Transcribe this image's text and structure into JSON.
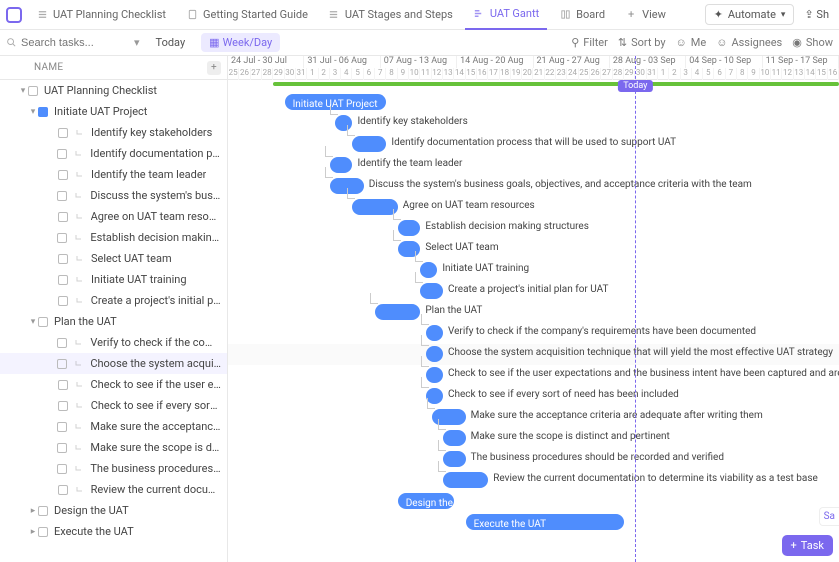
{
  "tabs": [
    {
      "label": "UAT Planning Checklist",
      "icon": "list-icon"
    },
    {
      "label": "Getting Started Guide",
      "icon": "doc-icon"
    },
    {
      "label": "UAT Stages and Steps",
      "icon": "list-icon"
    },
    {
      "label": "UAT Gantt",
      "icon": "gantt-icon",
      "active": true
    },
    {
      "label": "Board",
      "icon": "board-icon"
    },
    {
      "label": "View",
      "icon": "plus-icon"
    }
  ],
  "top_actions": {
    "automate": "Automate",
    "share": "Sh"
  },
  "toolbar": {
    "search_placeholder": "Search tasks...",
    "today": "Today",
    "range": "Week/Day",
    "filter": "Filter",
    "sort": "Sort by",
    "me": "Me",
    "assignees": "Assignees",
    "show": "Show"
  },
  "side": {
    "header": "NAME",
    "root": "UAT Planning Checklist",
    "groups": [
      {
        "label": "Initiate UAT Project",
        "expanded": true,
        "items": [
          "Identify key stakeholders",
          "Identify documentation pro...",
          "Identify the team leader",
          "Discuss the system's busin...",
          "Agree on UAT team resour...",
          "Establish decision making ...",
          "Select UAT team",
          "Initiate UAT training",
          "Create a project's initial pl..."
        ]
      },
      {
        "label": "Plan the UAT",
        "expanded": true,
        "items": [
          "Verify to check if the comp...",
          "Choose the system acquisi...",
          "Check to see if the user ex...",
          "Check to see if every sort ...",
          "Make sure the acceptance ...",
          "Make sure the scope is dis...",
          "The business procedures s...",
          "Review the current docum..."
        ]
      },
      {
        "label": "Design the UAT",
        "expanded": false,
        "items": []
      },
      {
        "label": "Execute the UAT",
        "expanded": false,
        "items": []
      }
    ]
  },
  "timeline": {
    "weeks": [
      "24 Jul - 30 Jul",
      "31 Jul - 06 Aug",
      "07 Aug - 13 Aug",
      "14 Aug - 20 Aug",
      "21 Aug - 27 Aug",
      "28 Aug - 03 Sep",
      "04 Sep - 10 Sep",
      "11 Sep - 17 Sep"
    ],
    "days": [
      "25",
      "26",
      "27",
      "28",
      "29",
      "30",
      "31",
      "1",
      "2",
      "3",
      "4",
      "5",
      "6",
      "7",
      "8",
      "9",
      "10",
      "11",
      "12",
      "13",
      "14",
      "15",
      "16",
      "17",
      "18",
      "19",
      "20",
      "21",
      "22",
      "23",
      "24",
      "25",
      "26",
      "27",
      "28",
      "29",
      "30",
      "31",
      "1",
      "2",
      "3",
      "4",
      "5",
      "6",
      "7",
      "8",
      "9",
      "10",
      "11",
      "12",
      "13",
      "14",
      "15",
      "16"
    ],
    "today_label": "Today",
    "today_index": 36,
    "progress": {
      "start": 4,
      "end": 54
    },
    "bars": [
      {
        "label": "Initiate UAT Project",
        "start": 5,
        "len": 9,
        "inside": true,
        "hl": false
      },
      {
        "label": "Identify key stakeholders",
        "start": 9.5,
        "len": 1.5,
        "hl": false
      },
      {
        "label": "Identify documentation process that will be used to support UAT",
        "start": 11,
        "len": 3,
        "hl": false
      },
      {
        "label": "Identify the team leader",
        "start": 9,
        "len": 2,
        "hl": false
      },
      {
        "label": "Discuss the system's business goals, objectives, and acceptance criteria with the team",
        "start": 9,
        "len": 3,
        "hl": false
      },
      {
        "label": "Agree on UAT team resources",
        "start": 11,
        "len": 4,
        "hl": false
      },
      {
        "label": "Establish decision making structures",
        "start": 15,
        "len": 2,
        "hl": false
      },
      {
        "label": "Select UAT team",
        "start": 15,
        "len": 2,
        "hl": false
      },
      {
        "label": "Initiate UAT training",
        "start": 17,
        "len": 1.5,
        "hl": false
      },
      {
        "label": "Create a project's initial plan for UAT",
        "start": 17,
        "len": 2,
        "hl": false
      },
      {
        "label": "Plan the UAT",
        "start": 13,
        "len": 4,
        "hl": false
      },
      {
        "label": "Verify to check if the company's requirements have been documented",
        "start": 17.5,
        "len": 1.5,
        "hl": false
      },
      {
        "label": "Choose the system acquisition technique that will yield the most effective UAT strategy",
        "start": 17.5,
        "len": 1.5,
        "hl": true
      },
      {
        "label": "Check to see if the user expectations and the business intent have been captured and are measurable",
        "start": 17.5,
        "len": 1.5,
        "hl": false
      },
      {
        "label": "Check to see if every sort of need has been included",
        "start": 17.5,
        "len": 1.5,
        "hl": false
      },
      {
        "label": "Make sure the acceptance criteria are adequate after writing them",
        "start": 18,
        "len": 3,
        "hl": false
      },
      {
        "label": "Make sure the scope is distinct and pertinent",
        "start": 19,
        "len": 2,
        "hl": false
      },
      {
        "label": "The business procedures should be recorded and verified",
        "start": 19,
        "len": 2,
        "hl": false
      },
      {
        "label": "Review the current documentation to determine its viability as a test base",
        "start": 19,
        "len": 4,
        "hl": false
      },
      {
        "label": "Design the UAT",
        "start": 15,
        "len": 5,
        "inside": true,
        "hl": false
      },
      {
        "label": "Execute the UAT",
        "start": 21,
        "len": 14,
        "inside": true,
        "hl": false
      }
    ]
  },
  "footer": {
    "save": "Sa",
    "task": "Task"
  }
}
